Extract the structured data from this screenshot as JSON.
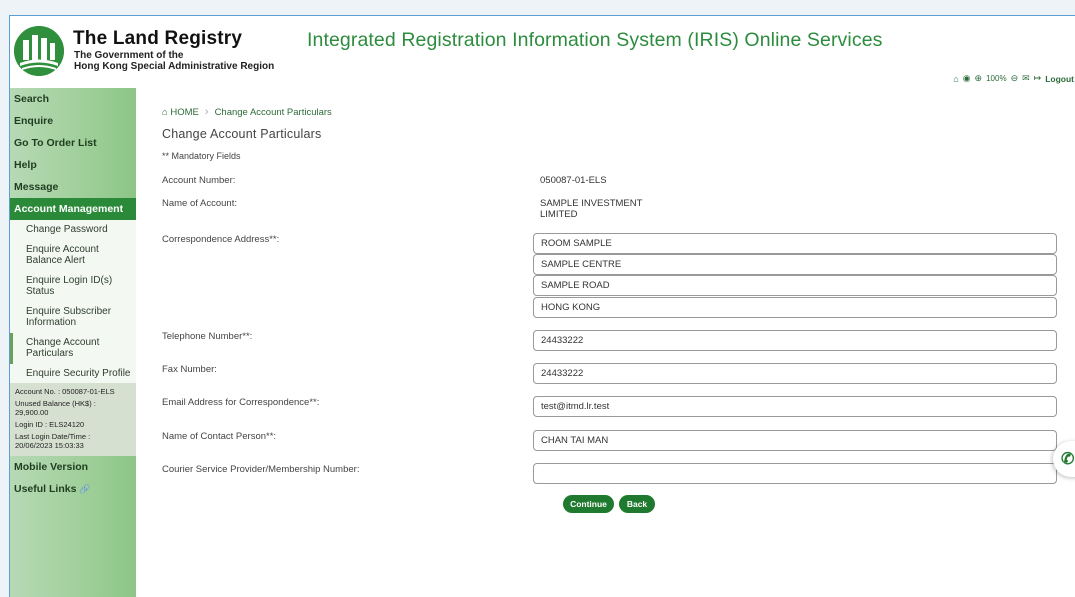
{
  "brand": {
    "title": "The Land Registry",
    "sub1": "The Government of the",
    "sub2": "Hong Kong Special Administrative Region"
  },
  "system_title": "Integrated Registration Information System (IRIS) Online Services",
  "utility": {
    "zoom": "100%",
    "logout": "Logout"
  },
  "sidebar": {
    "top_items": [
      "Search",
      "Enquire",
      "Go To Order List",
      "Help",
      "Message"
    ],
    "active_section": "Account Management",
    "sub_items": [
      "Change Password",
      "Enquire Account Balance Alert",
      "Enquire Login ID(s) Status",
      "Enquire Subscriber Information",
      "Change Account Particulars",
      "Enquire Security Profile"
    ],
    "account_info": {
      "account_no": "Account No. : 050087-01-ELS",
      "balance_label": "Unused Balance (HK$) :",
      "balance_value": "29,900.00",
      "login_id": "Login ID : ELS24120",
      "last_login_label": "Last Login Date/Time :",
      "last_login_value": "20/06/2023 15:03:33"
    },
    "bottom_items": [
      "Mobile Version",
      "Useful Links"
    ]
  },
  "breadcrumb": {
    "home": "HOME",
    "current": "Change Account Particulars"
  },
  "page_title": "Change Account Particulars",
  "mandatory_note": "** Mandatory Fields",
  "form": {
    "account_number_label": "Account Number:",
    "account_number_value": "050087-01-ELS",
    "account_name_label": "Name of Account:",
    "account_name_line1": "SAMPLE INVESTMENT",
    "account_name_line2": "LIMITED",
    "address_label": "Correspondence Address**:",
    "address": [
      "ROOM SAMPLE",
      "SAMPLE CENTRE",
      "SAMPLE ROAD",
      "HONG KONG"
    ],
    "telephone_label": "Telephone Number**:",
    "telephone_value": "24433222",
    "fax_label": "Fax Number:",
    "fax_value": "24433222",
    "email_label": "Email Address for Correspondence**:",
    "email_value": "test@itmd.lr.test",
    "contact_label": "Name of Contact Person**:",
    "contact_value": "CHAN TAI MAN",
    "courier_label": "Courier Service Provider/Membership Number:",
    "courier_value": ""
  },
  "buttons": {
    "continue": "Continue",
    "back": "Back"
  },
  "colors": {
    "brand_green": "#2d8c3e",
    "active_nav": "#2b8a39",
    "button": "#1f7a30"
  }
}
